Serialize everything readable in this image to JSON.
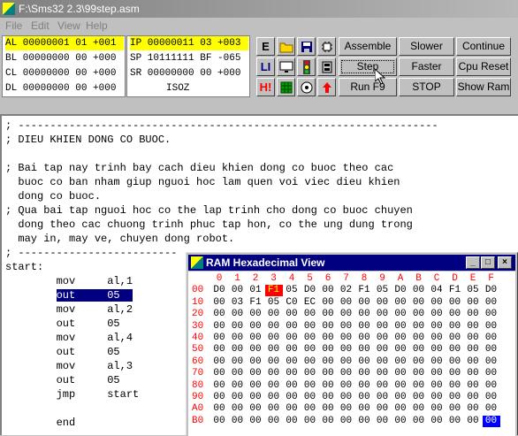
{
  "title_bar": {
    "title": "F:\\Sms32 2.3\\99step.asm"
  },
  "menu": [
    {
      "label": "File"
    },
    {
      "label": "Edit"
    },
    {
      "label": "View"
    },
    {
      "label": "Help"
    }
  ],
  "registers": {
    "left": [
      "AL 00000001 01 +001",
      "BL 00000000 00 +000",
      "CL 00000000 00 +000",
      "DL 00000000 00 +000"
    ],
    "right": [
      "IP 00000011 03 +003",
      "SP 10111111 BF -065",
      "SR 00000000 00 +000",
      "ISOZ"
    ]
  },
  "toolbar_icons": [
    {
      "name": "e-icon",
      "glyph": "E",
      "color": "#000000"
    },
    {
      "name": "open-folder-icon",
      "glyph": "📂",
      "color": "#806000"
    },
    {
      "name": "save-disk-icon",
      "glyph": "💾",
      "color": "#000080"
    },
    {
      "name": "chip-icon",
      "glyph": "⚙",
      "color": "#000000"
    },
    {
      "name": "li-icon",
      "glyph": "LI",
      "color": "#000080"
    },
    {
      "name": "monitor-icon",
      "glyph": "🖥",
      "color": "#000000"
    },
    {
      "name": "traffic-light-icon",
      "glyph": "🚦",
      "color": "#000000"
    },
    {
      "name": "device-icon",
      "glyph": "▣",
      "color": "#000000"
    },
    {
      "name": "hi-icon",
      "glyph": "H!",
      "color": "#ff0000"
    },
    {
      "name": "keypad-icon",
      "glyph": "▦",
      "color": "#008000"
    },
    {
      "name": "stepper-motor-icon",
      "glyph": "◎",
      "color": "#000000"
    },
    {
      "name": "up-arrow-icon",
      "glyph": "⬆",
      "color": "#ff0000"
    }
  ],
  "buttons": {
    "assemble": "Assemble",
    "slower": "Slower",
    "continue": "Continue",
    "step": "Step",
    "faster": "Faster",
    "cpu_reset": "Cpu Reset",
    "run": "Run F9",
    "stop": "STOP",
    "show_ram": "Show Ram"
  },
  "source_lines": [
    "; ------------------------------------------------------------------",
    "; DIEU KHIEN DONG CO BUOC.",
    "",
    "; Bai tap nay trinh bay cach dieu khien dong co buoc theo cac",
    "  buoc co ban nham giup nguoi hoc lam quen voi viec dieu khien",
    "  dong co buoc.",
    "; Qua bai tap nguoi hoc co the lap trinh cho dong co buoc chuyen",
    "  dong theo cac chuong trinh phuc tap hon, co the ung dung trong",
    "  may in, may ve, chuyen dong robot.",
    "; -------------------------",
    "start:",
    "        mov     al,1",
    "        out     05",
    "        mov     al,2",
    "        out     05",
    "        mov     al,4",
    "        out     05",
    "        mov     al,3",
    "        out     05",
    "        jmp     start",
    "",
    "        end"
  ],
  "highlighted_line": 12,
  "highlighted_text": "out     05",
  "ram_window": {
    "title": "RAM Hexadecimal View",
    "col_headers": [
      "0",
      "1",
      "2",
      "3",
      "4",
      "5",
      "6",
      "7",
      "8",
      "9",
      "A",
      "B",
      "C",
      "D",
      "E",
      "F"
    ],
    "rows": [
      {
        "addr": "00",
        "cells": [
          "D0",
          "00",
          "01",
          "F1",
          "05",
          "D0",
          "00",
          "02",
          "F1",
          "05",
          "D0",
          "00",
          "04",
          "F1",
          "05",
          "D0"
        ]
      },
      {
        "addr": "10",
        "cells": [
          "00",
          "03",
          "F1",
          "05",
          "C0",
          "EC",
          "00",
          "00",
          "00",
          "00",
          "00",
          "00",
          "00",
          "00",
          "00",
          "00"
        ]
      },
      {
        "addr": "20",
        "cells": [
          "00",
          "00",
          "00",
          "00",
          "00",
          "00",
          "00",
          "00",
          "00",
          "00",
          "00",
          "00",
          "00",
          "00",
          "00",
          "00"
        ]
      },
      {
        "addr": "30",
        "cells": [
          "00",
          "00",
          "00",
          "00",
          "00",
          "00",
          "00",
          "00",
          "00",
          "00",
          "00",
          "00",
          "00",
          "00",
          "00",
          "00"
        ]
      },
      {
        "addr": "40",
        "cells": [
          "00",
          "00",
          "00",
          "00",
          "00",
          "00",
          "00",
          "00",
          "00",
          "00",
          "00",
          "00",
          "00",
          "00",
          "00",
          "00"
        ]
      },
      {
        "addr": "50",
        "cells": [
          "00",
          "00",
          "00",
          "00",
          "00",
          "00",
          "00",
          "00",
          "00",
          "00",
          "00",
          "00",
          "00",
          "00",
          "00",
          "00"
        ]
      },
      {
        "addr": "60",
        "cells": [
          "00",
          "00",
          "00",
          "00",
          "00",
          "00",
          "00",
          "00",
          "00",
          "00",
          "00",
          "00",
          "00",
          "00",
          "00",
          "00"
        ]
      },
      {
        "addr": "70",
        "cells": [
          "00",
          "00",
          "00",
          "00",
          "00",
          "00",
          "00",
          "00",
          "00",
          "00",
          "00",
          "00",
          "00",
          "00",
          "00",
          "00"
        ]
      },
      {
        "addr": "80",
        "cells": [
          "00",
          "00",
          "00",
          "00",
          "00",
          "00",
          "00",
          "00",
          "00",
          "00",
          "00",
          "00",
          "00",
          "00",
          "00",
          "00"
        ]
      },
      {
        "addr": "90",
        "cells": [
          "00",
          "00",
          "00",
          "00",
          "00",
          "00",
          "00",
          "00",
          "00",
          "00",
          "00",
          "00",
          "00",
          "00",
          "00",
          "00"
        ]
      },
      {
        "addr": "A0",
        "cells": [
          "00",
          "00",
          "00",
          "00",
          "00",
          "00",
          "00",
          "00",
          "00",
          "00",
          "00",
          "00",
          "00",
          "00",
          "00",
          "00"
        ]
      },
      {
        "addr": "B0",
        "cells": [
          "00",
          "00",
          "00",
          "00",
          "00",
          "00",
          "00",
          "00",
          "00",
          "00",
          "00",
          "00",
          "00",
          "00",
          "00",
          "00"
        ]
      }
    ],
    "ip_cell": {
      "row": 0,
      "col": 3
    },
    "sp_cell": {
      "row": 11,
      "col": 15
    }
  },
  "colors": {
    "register_highlight": "#ffff00",
    "selection": "#000080",
    "ram_label": "#ff0000",
    "ip_highlight": "#ff0000",
    "sp_highlight": "#0000ff"
  }
}
